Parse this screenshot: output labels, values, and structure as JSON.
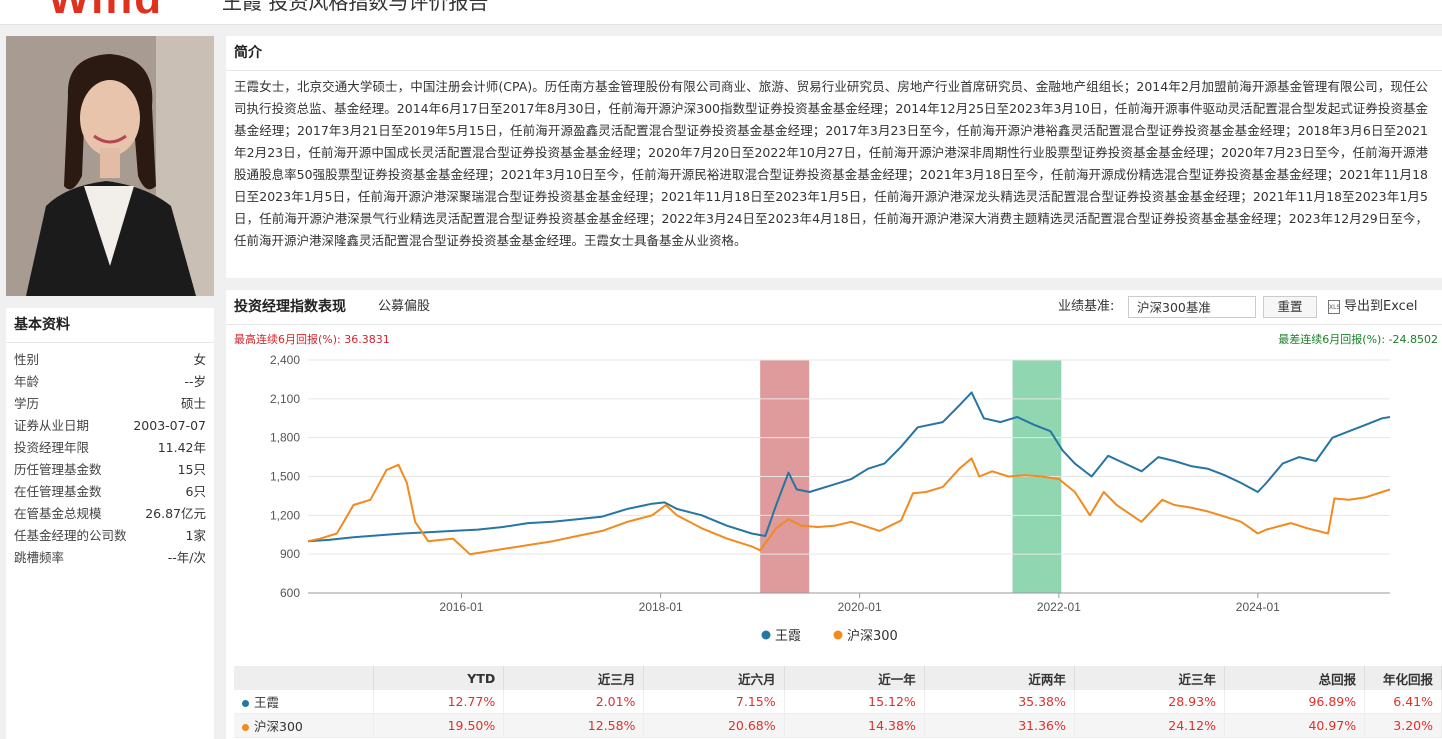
{
  "header": {
    "logo_text": "Wind",
    "heading": "王霞 投资风格指数与评价报告"
  },
  "basic_info": {
    "title": "基本资料",
    "rows": [
      {
        "label": "性别",
        "value": "女"
      },
      {
        "label": "年龄",
        "value": "--岁"
      },
      {
        "label": "学历",
        "value": "硕士"
      },
      {
        "label": "证券从业日期",
        "value": "2003-07-07"
      },
      {
        "label": "投资经理年限",
        "value": "11.42年"
      },
      {
        "label": "历任管理基金数",
        "value": "15只"
      },
      {
        "label": "在任管理基金数",
        "value": "6只"
      },
      {
        "label": "在管基金总规模",
        "value": "26.87亿元"
      },
      {
        "label": "任基金经理的公司数",
        "value": "1家"
      },
      {
        "label": "跳槽频率",
        "value": "--年/次"
      }
    ]
  },
  "intro": {
    "title": "简介",
    "text": "王霞女士，北京交通大学硕士，中国注册会计师(CPA)。历任南方基金管理股份有限公司商业、旅游、贸易行业研究员、房地产行业首席研究员、金融地产组组长；2014年2月加盟前海开源基金管理有限公司，现任公司执行投资总监、基金经理。2014年6月17日至2017年8月30日，任前海开源沪深300指数型证券投资基金基金经理；2014年12月25日至2023年3月10日，任前海开源事件驱动灵活配置混合型发起式证券投资基金基金经理；2017年3月21日至2019年5月15日，任前海开源盈鑫灵活配置混合型证券投资基金基金经理；2017年3月23日至今，任前海开源沪港裕鑫灵活配置混合型证券投资基金基金经理；2018年3月6日至2021年2月23日，任前海开源中国成长灵活配置混合型证券投资基金基金经理；2020年7月20日至2022年10月27日，任前海开源沪港深非周期性行业股票型证券投资基金基金经理；2020年7月23日至今，任前海开源港股通股息率50强股票型证券投资基金基金经理；2021年3月10日至今，任前海开源民裕进取混合型证券投资基金基金经理；2021年3月18日至今，任前海开源成份精选混合型证券投资基金基金经理；2021年11月18日至2023年1月5日，任前海开源沪港深聚瑞混合型证券投资基金基金经理；2021年11月18日至2023年1月5日，任前海开源沪港深龙头精选灵活配置混合型证券投资基金基金经理；2021年11月18至2023年1月5日，任前海开源沪港深景气行业精选灵活配置混合型证券投资基金基金经理；2022年3月24日至2023年4月18日，任前海开源沪港深大消费主题精选灵活配置混合型证券投资基金基金经理；2023年12月29日至今，任前海开源沪港深隆鑫灵活配置混合型证券投资基金基金经理。王霞女士具备基金从业资格。"
  },
  "chart_panel": {
    "title": "投资经理指数表现",
    "subtitle": "公募偏股",
    "bench_label": "业绩基准:",
    "bench_value": "沪深300基准",
    "reset_label": "重置",
    "export_label": "导出到Excel",
    "export_icon": "excel-icon",
    "max_up_label": "最高连续6月回报(%): 36.3831",
    "max_down_label": "最差连续6月回报(%): -24.8502"
  },
  "chart_data": {
    "type": "line",
    "title": "",
    "xlabel": "",
    "ylabel": "",
    "ylim": [
      600,
      2400
    ],
    "yticks": [
      600,
      900,
      1200,
      1500,
      1800,
      2100,
      2400
    ],
    "yticklabels": [
      "600",
      "900",
      "1,200",
      "1,500",
      "1,800",
      "2,100",
      "2,400"
    ],
    "xlim": [
      "2014-06-17",
      "2025-04-30"
    ],
    "xticks": [
      "2016-01-01",
      "2018-01-01",
      "2020-01-01",
      "2022-01-01",
      "2024-01-01"
    ],
    "xticklabels": [
      "2016-01",
      "2018-01",
      "2020-01",
      "2022-01",
      "2024-01"
    ],
    "grid": true,
    "legend": "bottom-center",
    "highlight_bands": [
      {
        "start": "2019-01-01",
        "end": "2019-06-30",
        "color": "#d98a8a"
      },
      {
        "start": "2021-07-15",
        "end": "2022-01-10",
        "color": "#7ccfa3"
      }
    ],
    "series": [
      {
        "name": "王霞",
        "color": "#2675a3",
        "points": [
          [
            "2014-06-17",
            1000
          ],
          [
            "2014-09-01",
            1010
          ],
          [
            "2014-12-01",
            1030
          ],
          [
            "2015-03-01",
            1045
          ],
          [
            "2015-06-01",
            1060
          ],
          [
            "2015-09-01",
            1070
          ],
          [
            "2015-12-01",
            1080
          ],
          [
            "2016-03-01",
            1090
          ],
          [
            "2016-06-01",
            1110
          ],
          [
            "2016-09-01",
            1140
          ],
          [
            "2016-12-01",
            1150
          ],
          [
            "2017-03-01",
            1170
          ],
          [
            "2017-06-01",
            1190
          ],
          [
            "2017-09-01",
            1250
          ],
          [
            "2017-12-01",
            1290
          ],
          [
            "2018-01-15",
            1300
          ],
          [
            "2018-03-01",
            1250
          ],
          [
            "2018-06-01",
            1200
          ],
          [
            "2018-09-01",
            1120
          ],
          [
            "2018-12-01",
            1060
          ],
          [
            "2019-01-20",
            1040
          ],
          [
            "2019-03-01",
            1280
          ],
          [
            "2019-04-15",
            1530
          ],
          [
            "2019-05-15",
            1400
          ],
          [
            "2019-07-01",
            1380
          ],
          [
            "2019-10-01",
            1440
          ],
          [
            "2019-12-01",
            1480
          ],
          [
            "2020-02-01",
            1560
          ],
          [
            "2020-04-01",
            1600
          ],
          [
            "2020-06-01",
            1730
          ],
          [
            "2020-08-01",
            1880
          ],
          [
            "2020-11-01",
            1920
          ],
          [
            "2021-01-01",
            2050
          ],
          [
            "2021-02-15",
            2150
          ],
          [
            "2021-04-01",
            1950
          ],
          [
            "2021-06-01",
            1920
          ],
          [
            "2021-08-01",
            1960
          ],
          [
            "2021-10-01",
            1900
          ],
          [
            "2021-12-01",
            1850
          ],
          [
            "2022-01-15",
            1700
          ],
          [
            "2022-03-01",
            1600
          ],
          [
            "2022-05-01",
            1500
          ],
          [
            "2022-07-01",
            1660
          ],
          [
            "2022-09-01",
            1600
          ],
          [
            "2022-11-01",
            1540
          ],
          [
            "2023-01-01",
            1650
          ],
          [
            "2023-03-01",
            1620
          ],
          [
            "2023-05-01",
            1580
          ],
          [
            "2023-07-01",
            1560
          ],
          [
            "2023-09-01",
            1510
          ],
          [
            "2023-11-01",
            1450
          ],
          [
            "2024-01-01",
            1380
          ],
          [
            "2024-02-01",
            1450
          ],
          [
            "2024-04-01",
            1600
          ],
          [
            "2024-06-01",
            1650
          ],
          [
            "2024-08-01",
            1620
          ],
          [
            "2024-10-01",
            1800
          ],
          [
            "2024-12-01",
            1850
          ],
          [
            "2025-02-01",
            1900
          ],
          [
            "2025-04-01",
            1950
          ],
          [
            "2025-04-30",
            1960
          ]
        ]
      },
      {
        "name": "沪深300",
        "color": "#f28a1e",
        "points": [
          [
            "2014-06-17",
            1000
          ],
          [
            "2014-08-01",
            1020
          ],
          [
            "2014-10-01",
            1060
          ],
          [
            "2014-12-01",
            1280
          ],
          [
            "2015-02-01",
            1320
          ],
          [
            "2015-04-01",
            1550
          ],
          [
            "2015-05-15",
            1590
          ],
          [
            "2015-06-15",
            1450
          ],
          [
            "2015-07-15",
            1150
          ],
          [
            "2015-09-01",
            1000
          ],
          [
            "2015-12-01",
            1020
          ],
          [
            "2016-02-01",
            900
          ],
          [
            "2016-06-01",
            940
          ],
          [
            "2016-09-01",
            970
          ],
          [
            "2016-12-01",
            1000
          ],
          [
            "2017-03-01",
            1040
          ],
          [
            "2017-06-01",
            1080
          ],
          [
            "2017-09-01",
            1150
          ],
          [
            "2017-12-01",
            1200
          ],
          [
            "2018-01-20",
            1280
          ],
          [
            "2018-03-01",
            1200
          ],
          [
            "2018-06-01",
            1100
          ],
          [
            "2018-09-01",
            1020
          ],
          [
            "2018-12-01",
            960
          ],
          [
            "2019-01-01",
            930
          ],
          [
            "2019-03-01",
            1100
          ],
          [
            "2019-04-15",
            1170
          ],
          [
            "2019-06-01",
            1120
          ],
          [
            "2019-08-01",
            1110
          ],
          [
            "2019-10-01",
            1120
          ],
          [
            "2019-12-01",
            1150
          ],
          [
            "2020-03-15",
            1080
          ],
          [
            "2020-06-01",
            1160
          ],
          [
            "2020-07-15",
            1370
          ],
          [
            "2020-09-01",
            1380
          ],
          [
            "2020-11-01",
            1420
          ],
          [
            "2021-01-01",
            1560
          ],
          [
            "2021-02-15",
            1640
          ],
          [
            "2021-03-15",
            1500
          ],
          [
            "2021-05-01",
            1540
          ],
          [
            "2021-07-01",
            1500
          ],
          [
            "2021-09-01",
            1510
          ],
          [
            "2021-11-01",
            1500
          ],
          [
            "2022-01-01",
            1480
          ],
          [
            "2022-03-01",
            1380
          ],
          [
            "2022-04-25",
            1200
          ],
          [
            "2022-06-15",
            1380
          ],
          [
            "2022-08-01",
            1280
          ],
          [
            "2022-10-31",
            1150
          ],
          [
            "2023-01-15",
            1320
          ],
          [
            "2023-03-01",
            1280
          ],
          [
            "2023-05-01",
            1260
          ],
          [
            "2023-07-01",
            1230
          ],
          [
            "2023-09-01",
            1190
          ],
          [
            "2023-11-01",
            1150
          ],
          [
            "2024-01-01",
            1060
          ],
          [
            "2024-02-01",
            1090
          ],
          [
            "2024-05-01",
            1140
          ],
          [
            "2024-07-01",
            1100
          ],
          [
            "2024-09-15",
            1060
          ],
          [
            "2024-10-08",
            1330
          ],
          [
            "2024-12-01",
            1320
          ],
          [
            "2025-02-01",
            1340
          ],
          [
            "2025-04-01",
            1380
          ],
          [
            "2025-04-30",
            1400
          ]
        ]
      }
    ]
  },
  "perf_table": {
    "columns": [
      "",
      "YTD",
      "近三月",
      "近六月",
      "近一年",
      "近两年",
      "近三年",
      "总回报",
      "年化回报"
    ],
    "rows": [
      {
        "name": "王霞",
        "color": "#2675a3",
        "values": [
          "12.77%",
          "2.01%",
          "7.15%",
          "15.12%",
          "35.38%",
          "28.93%",
          "96.89%",
          "6.41%"
        ]
      },
      {
        "name": "沪深300",
        "color": "#f28a1e",
        "values": [
          "19.50%",
          "12.58%",
          "20.68%",
          "14.38%",
          "31.36%",
          "24.12%",
          "40.97%",
          "3.20%"
        ]
      }
    ]
  }
}
